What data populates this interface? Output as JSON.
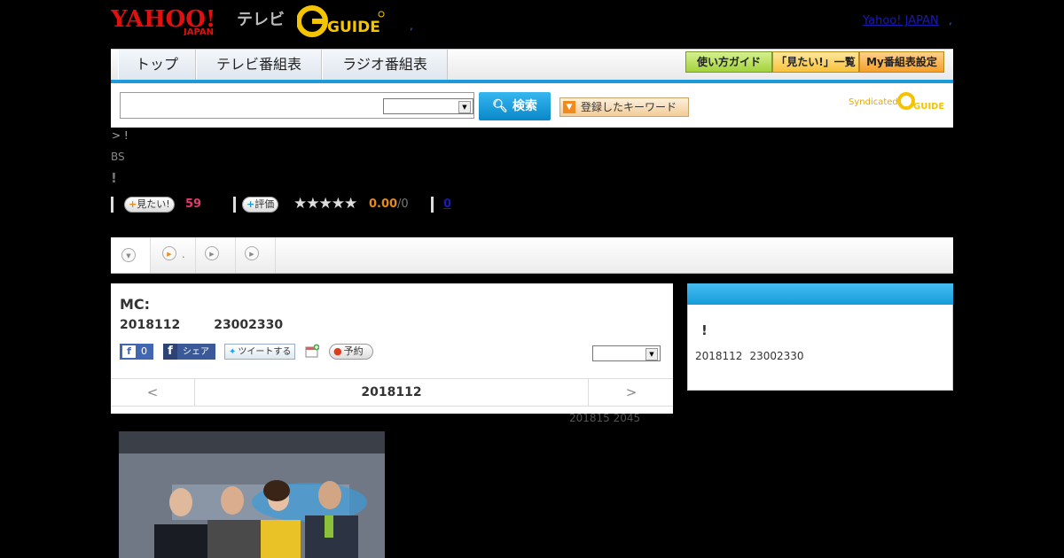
{
  "header": {
    "logo_yahoo": "YAHOO!",
    "logo_japan": "JAPAN",
    "logo_tv": "テレビ",
    "logo_gguide": "GUIDE",
    "dot_left": ",",
    "yahoo_japan_link": "Yahoo! JAPAN",
    "dot_right": ","
  },
  "nav": {
    "tabs": [
      {
        "label": "トップ"
      },
      {
        "label": "テレビ番組表"
      },
      {
        "label": "ラジオ番組表"
      }
    ],
    "buttons": [
      {
        "label": "使い方ガイド",
        "color": "#a4d23c"
      },
      {
        "label": "「見たい!」一覧",
        "color": "#f8c23c"
      },
      {
        "label": "My番組表設定",
        "color": "#f5a02a"
      }
    ]
  },
  "search": {
    "input_value": "",
    "select_value": "",
    "button_label": "検索",
    "keyword_button_label": "登録したキーワード",
    "syndicated_label": "Syndicated",
    "syndicated_logo": "GUIDE"
  },
  "program": {
    "breadcrumb": "> !",
    "channel": "BS",
    "title": "!",
    "want_label": "見たい!",
    "want_count": "59",
    "rate_label": "評価",
    "stars": "★★★★★",
    "rating": "0.00",
    "rating_denominator": "/0",
    "review_count": "0"
  },
  "tabs": {
    "tab2_label": "."
  },
  "detail": {
    "mc": "MC:",
    "date_left": "2018112",
    "time_left": "23002330",
    "fb_like_count": "0",
    "share_label": "シェア",
    "tweet_label": "ツイートする",
    "reserve_label": "予約",
    "select_value": "",
    "prev_label": "<",
    "nav_date": "2018112",
    "next_label": ">",
    "updated": "201815  2045"
  },
  "side": {
    "title": "!",
    "date": "2018112",
    "time": "23002330"
  }
}
